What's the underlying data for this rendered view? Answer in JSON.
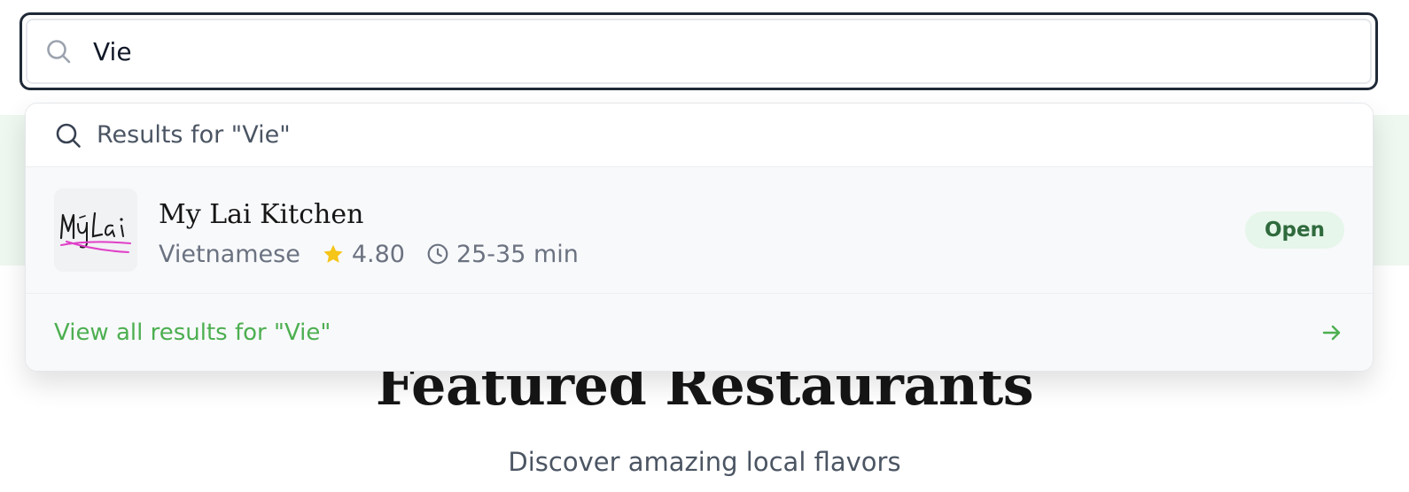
{
  "search": {
    "value": "Vie",
    "placeholder": ""
  },
  "dropdown": {
    "header": "Results for \"Vie\"",
    "results": [
      {
        "name": "My Lai Kitchen",
        "cuisine": "Vietnamese",
        "rating": "4.80",
        "delivery_time": "25-35 min",
        "status": "Open",
        "logo_icon": "my-lai-logo"
      }
    ],
    "view_all": "View all results for \"Vie\""
  },
  "featured": {
    "title": "Featured Restaurants",
    "subtitle": "Discover amazing local flavors"
  },
  "colors": {
    "accent_green": "#4caf50",
    "badge_bg": "#e6f6ea",
    "badge_text": "#2f6a3d",
    "star": "#f5c518",
    "border_dark": "#1f2937"
  },
  "icons": {
    "search": "search-icon",
    "star": "star-icon",
    "clock": "clock-icon",
    "arrow": "arrow-right-icon"
  }
}
